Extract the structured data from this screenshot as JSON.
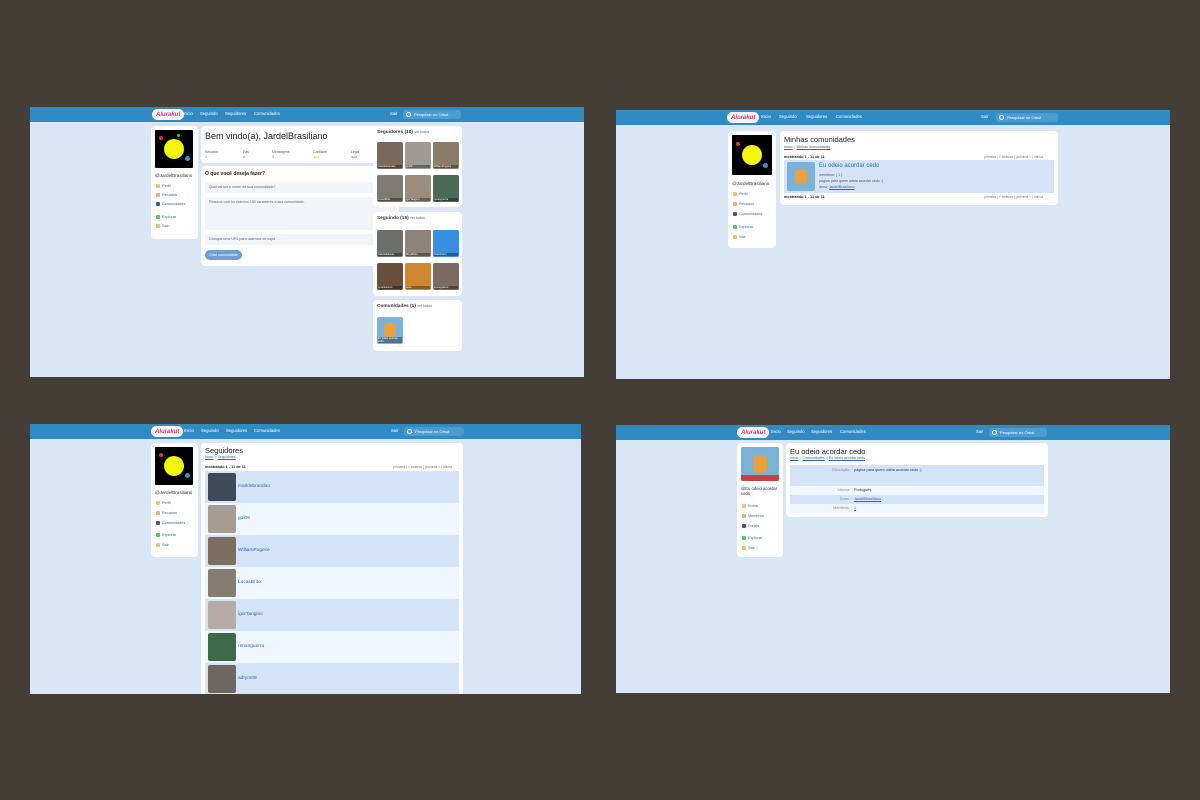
{
  "app": {
    "logo": "Alurakut",
    "nav": [
      "Inicio",
      "Seguindo",
      "Seguidores",
      "Comunidades"
    ],
    "sair": "Sair",
    "search_placeholder": "Pesquisar no Orkut"
  },
  "user": {
    "username": "@JardelBrasiliano"
  },
  "sidebar": {
    "items": [
      {
        "label": "Perfil",
        "icon": "user-icon"
      },
      {
        "label": "Recados",
        "icon": "book-icon"
      },
      {
        "label": "Comunidades",
        "icon": "community-icon"
      },
      {
        "label": "Explorar",
        "icon": "plus-icon"
      },
      {
        "label": "Sair",
        "icon": "logout-icon"
      }
    ],
    "community_items": [
      {
        "label": "Entrar",
        "icon": "user-icon"
      },
      {
        "label": "Membros",
        "icon": "book-icon"
      },
      {
        "label": "Fórum",
        "icon": "community-icon"
      },
      {
        "label": "Explorar",
        "icon": "plus-icon"
      },
      {
        "label": "Sair",
        "icon": "logout-icon"
      }
    ]
  },
  "home": {
    "welcome": "Bem vindo(a), JardelBrasiliano",
    "stats": [
      {
        "label": "Recados",
        "value": "3"
      },
      {
        "label": "Fãs",
        "value": "8"
      },
      {
        "label": "Mensagens",
        "value": "3"
      },
      {
        "label": "Confiável",
        "value": ""
      },
      {
        "label": "Legal",
        "value": ""
      }
    ],
    "form_title": "O que você deseja fazer?",
    "input_name": "Qual vai ser o nome da sua comunidade?",
    "input_desc": "Resuma com no máximo 180 caracteres a sua comunidade.",
    "input_url": "Coloque uma URL para usarmos de capa",
    "submit": "Criar comunidade",
    "followers_title": "Seguidores (10)",
    "following_title": "Seguindo (15)",
    "communities_title": "Comunidades (1)",
    "ver_todos": "ver todos",
    "followers": [
      "marklebrandao",
      "gui09",
      "WilliamPogece",
      "LucasBrito",
      "igorTangino",
      "renanguerra"
    ],
    "following": [
      "Gabrielbatista",
      "MaykBrito",
      "JoaoPedro",
      "omariosouto",
      "peas",
      "juunegreiros"
    ],
    "community_card": "Eu odeio acordar cedo"
  },
  "communities": {
    "title": "Minhas comunidades",
    "breadcrumb": [
      "Inicio",
      "Minhas comunidades"
    ],
    "mostrando": "mostrando 1 - 11 de 11",
    "pager": "primeira | < anterior | próxima > | última",
    "item": {
      "name": "Eu odeio acordar cedo",
      "members": "membros: ( 1 )",
      "description": "pagina para quem odeia acordar cedo :)",
      "owner_label": "dono:",
      "owner": "JardelBrasiliano"
    }
  },
  "followers_page": {
    "title": "Seguidores",
    "breadcrumb": [
      "Inicio",
      "Seguidores"
    ],
    "mostrando": "mostrando 1 - 11 de 11",
    "pager": "primeira | < anterior | próxima > | última",
    "list": [
      "marklebrandao",
      "gui09",
      "WilliamPogece",
      "LucasBrito",
      "igorTangino",
      "renanguerra",
      "adrym09"
    ]
  },
  "community_detail": {
    "title": "Eu odeio acordar cedo",
    "breadcrumb": [
      "Inicio",
      "Comunidades",
      "Eu odeio acordar cedo"
    ],
    "side_name": "@Eu odeio acordar cedo",
    "rows": [
      {
        "label": "Descrição:",
        "value": "pagina para quem odeia acordar cedo :)"
      },
      {
        "label": "Idioma:",
        "value": "Português"
      },
      {
        "label": "Dono:",
        "value": "JardelBrasiliano"
      },
      {
        "label": "Membros:",
        "value": "1"
      }
    ]
  },
  "colors": {
    "topbar": "#308bc5",
    "background": "#d9e6f6",
    "link": "#2e6aa8",
    "logo": "#e32a79"
  }
}
